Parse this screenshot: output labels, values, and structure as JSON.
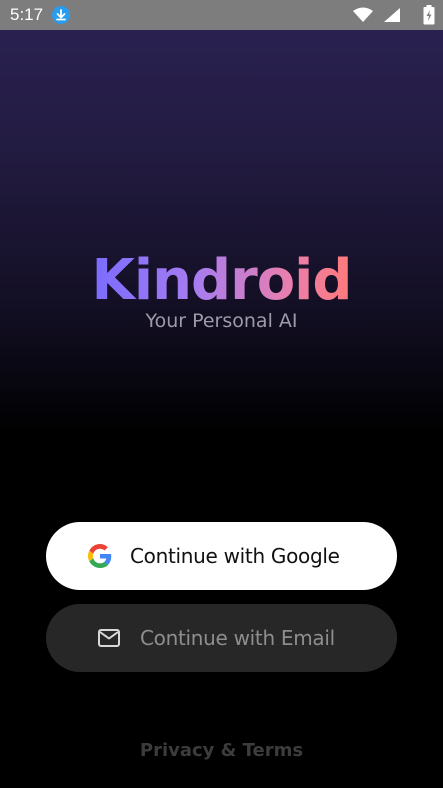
{
  "status_bar": {
    "time": "5:17",
    "icons": [
      "download-icon",
      "wifi-icon",
      "signal-icon",
      "battery-icon"
    ]
  },
  "brand": {
    "name": "Kindroid",
    "tagline": "Your Personal AI"
  },
  "actions": {
    "google_label": "Continue with Google",
    "email_label": "Continue with Email"
  },
  "footer": {
    "privacy_terms_label": "Privacy & Terms"
  },
  "colors": {
    "logo_gradient_start": "#7b6cff",
    "logo_gradient_end": "#ff7a7a",
    "google_button_bg": "#ffffff",
    "email_button_bg": "#272727"
  }
}
